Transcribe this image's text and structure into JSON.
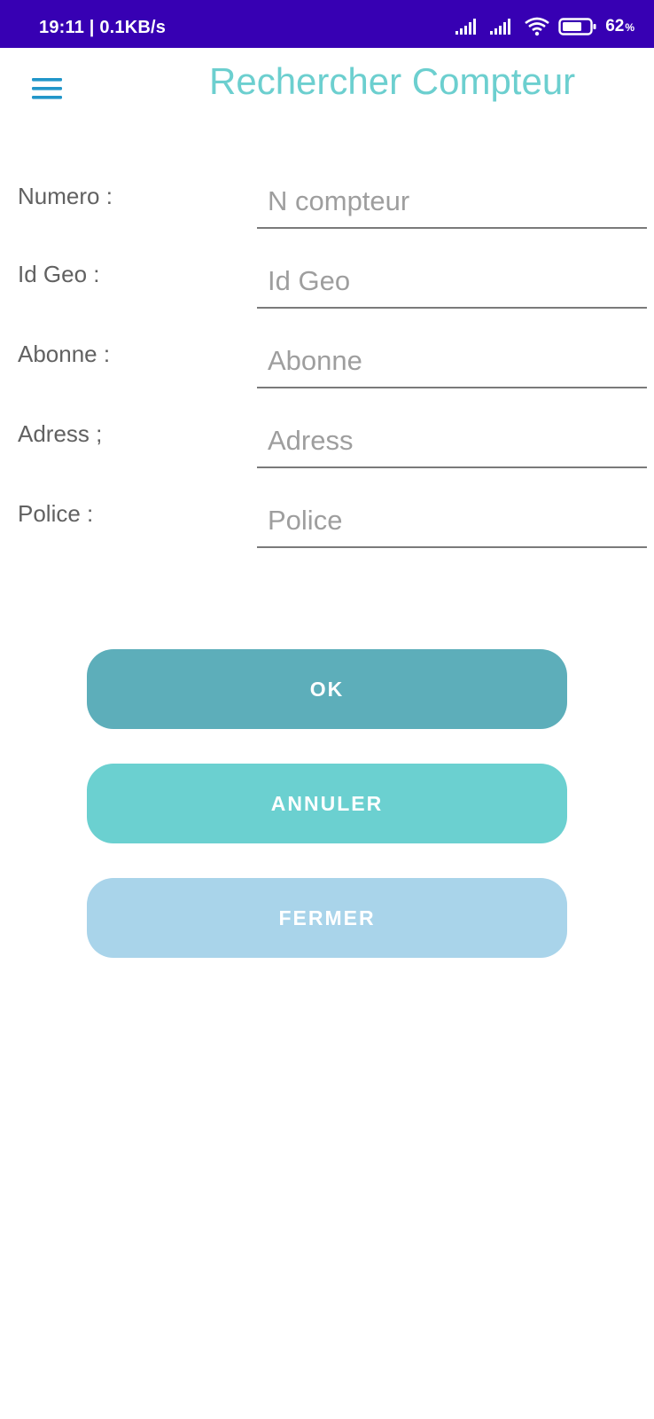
{
  "status_bar": {
    "time_speed": "19:11 | 0.1KB/s",
    "battery_percent": "62",
    "battery_percent_sign": "%",
    "icons": [
      "signal-icon",
      "signal-icon",
      "wifi-icon",
      "battery-icon"
    ]
  },
  "header": {
    "menu_icon": "hamburger-menu-icon",
    "title": "Rechercher Compteur"
  },
  "form": {
    "fields": [
      {
        "label": "Numero :",
        "placeholder": "N compteur",
        "value": ""
      },
      {
        "label": "Id Geo :",
        "placeholder": "Id Geo",
        "value": ""
      },
      {
        "label": "Abonne :",
        "placeholder": "Abonne",
        "value": ""
      },
      {
        "label": "Adress ;",
        "placeholder": "Adress",
        "value": ""
      },
      {
        "label": "Police :",
        "placeholder": "Police",
        "value": ""
      }
    ]
  },
  "buttons": {
    "ok_label": "OK",
    "annuler_label": "ANNULER",
    "fermer_label": "FERMER"
  },
  "colors": {
    "status_bar": "#3700b3",
    "title": "#6ccfcf",
    "menu_icon": "#2196c9",
    "ok_button": "#5daeba",
    "annuler_button": "#6bd0d0",
    "fermer_button": "#a9d4ea"
  }
}
